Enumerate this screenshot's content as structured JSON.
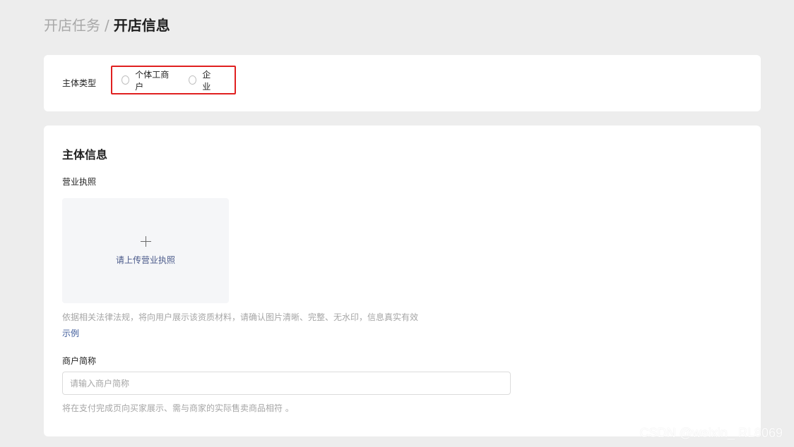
{
  "breadcrumb": {
    "parent": "开店任务",
    "separator": "/",
    "current": "开店信息"
  },
  "entity_type": {
    "label": "主体类型",
    "options": [
      {
        "label": "个体工商户",
        "selected": false
      },
      {
        "label": "企业",
        "selected": false
      }
    ]
  },
  "entity_info": {
    "title": "主体信息",
    "license": {
      "label": "营业执照",
      "upload_text": "请上传营业执照",
      "upload_icon": "plus-icon",
      "hint": "依据相关法律法规，将向用户展示该资质材料，请确认图片清晰、完整、无水印，信息真实有效",
      "example_link": "示例"
    },
    "short_name": {
      "label": "商户简称",
      "value": "",
      "placeholder": "请输入商户简称",
      "hint": "将在支付完成页向买家展示、需与商家的实际售卖商品相符 。"
    }
  },
  "watermark": "CSDN @weixin_ RL8069",
  "colors": {
    "background": "#ededed",
    "card": "#ffffff",
    "highlight_border": "#e02020",
    "link": "#3d5a9a",
    "hint": "#a6a6a6"
  }
}
